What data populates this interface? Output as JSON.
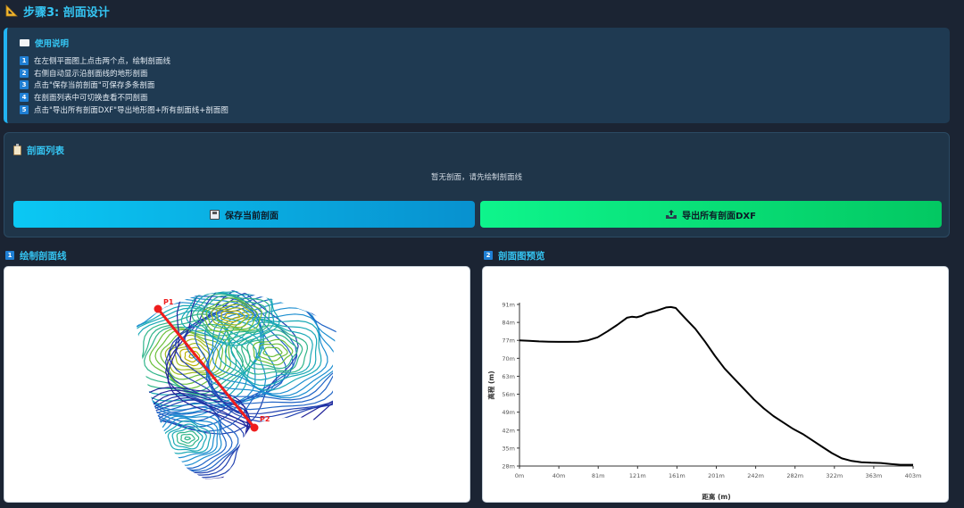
{
  "page": {
    "title": "步骤3: 剖面设计"
  },
  "instructions": {
    "title": "使用说明",
    "items": [
      {
        "num": "1",
        "text": "在左侧平面图上点击两个点，绘制剖面线"
      },
      {
        "num": "2",
        "text": "右侧自动显示沿剖面线的地形剖面"
      },
      {
        "num": "3",
        "text": "点击\"保存当前剖面\"可保存多条剖面"
      },
      {
        "num": "4",
        "text": "在剖面列表中可切换查看不同剖面"
      },
      {
        "num": "5",
        "text": "点击\"导出所有剖面DXF\"导出地形图+所有剖面线+剖面图"
      }
    ]
  },
  "profile_list": {
    "title": "剖面列表",
    "empty_text": "暂无剖面，请先绘制剖面线",
    "save_button": "保存当前剖面",
    "export_button": "导出所有剖面DXF"
  },
  "draw_section": {
    "num": "1",
    "title": "绘制剖面线",
    "point1_label": "P1",
    "point2_label": "P2"
  },
  "preview_section": {
    "num": "2",
    "title": "剖面图预览"
  },
  "chart_data": {
    "type": "line",
    "xlabel": "距离 (m)",
    "ylabel": "高程 (m)",
    "x_ticks": [
      "0m",
      "40m",
      "81m",
      "121m",
      "161m",
      "201m",
      "242m",
      "282m",
      "322m",
      "363m",
      "403m"
    ],
    "y_ticks": [
      "28m",
      "35m",
      "42m",
      "49m",
      "56m",
      "63m",
      "70m",
      "77m",
      "84m",
      "91m"
    ],
    "xlim": [
      0,
      403
    ],
    "ylim": [
      28,
      91
    ],
    "grid": false,
    "series": [
      {
        "color": "#000000",
        "x": [
          0,
          10,
          20,
          30,
          40,
          50,
          60,
          70,
          80,
          90,
          100,
          110,
          115,
          120,
          125,
          130,
          140,
          150,
          155,
          160,
          165,
          170,
          180,
          190,
          200,
          210,
          220,
          230,
          240,
          250,
          260,
          270,
          280,
          290,
          300,
          310,
          320,
          330,
          340,
          350,
          360,
          370,
          380,
          390,
          403
        ],
        "y": [
          77.0,
          76.8,
          76.6,
          76.5,
          76.4,
          76.4,
          76.5,
          77.0,
          78.2,
          80.5,
          83.0,
          85.8,
          86.2,
          86.0,
          86.5,
          87.5,
          88.5,
          89.8,
          90.0,
          89.6,
          87.5,
          85.5,
          81.5,
          76.5,
          71.0,
          66.0,
          62.0,
          58.0,
          54.0,
          50.5,
          47.5,
          45.0,
          42.5,
          40.5,
          38.0,
          35.5,
          33.0,
          31.0,
          30.0,
          29.5,
          29.3,
          29.2,
          28.8,
          28.5,
          28.5
        ]
      }
    ]
  }
}
